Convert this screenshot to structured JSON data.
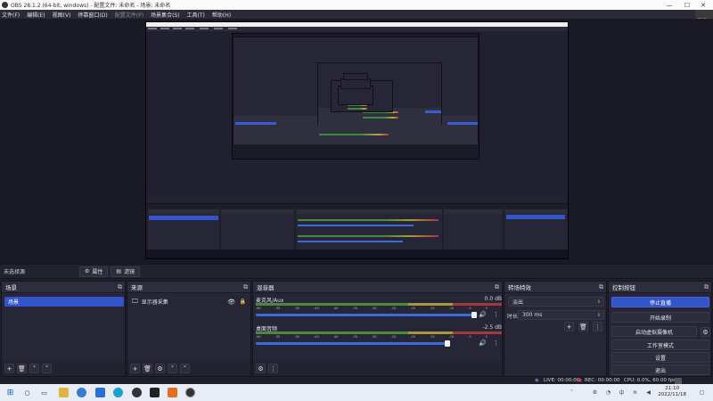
{
  "window": {
    "title": "OBS 28.1.2 (64-bit, windows) - 配置文件: 未命名 - 场景: 未命名",
    "minimize": "—",
    "maximize": "☐",
    "close": "✕",
    "badge": "翻譯中"
  },
  "menu": [
    "文件(F)",
    "编辑(E)",
    "视图(V)",
    "停靠窗口(D)",
    "配置文件(P)",
    "场景集合(S)",
    "工具(T)",
    "帮助(H)"
  ],
  "scenebar": {
    "label": "未选择源",
    "properties": "属性",
    "filters": "滤镜"
  },
  "scenes": {
    "title": "场景",
    "items": [
      "场景"
    ]
  },
  "sources": {
    "title": "来源",
    "items": [
      "显示器采集"
    ]
  },
  "mixer": {
    "title": "混音器",
    "tracks": [
      {
        "name": "麦克风/Aux",
        "db": "0.0 dB",
        "level": 0.63,
        "fader": 0.9
      },
      {
        "name": "桌面音频",
        "db": "-2.5 dB",
        "level": 0.63,
        "fader": 0.78
      }
    ],
    "ticks": [
      "-60",
      "-55",
      "-50",
      "-45",
      "-40",
      "-35",
      "-30",
      "-25",
      "-20",
      "-15",
      "-10",
      "-5",
      "0"
    ]
  },
  "transitions": {
    "title": "转场特效",
    "type": "淡出",
    "duration_label": "时长",
    "duration": "300 ms"
  },
  "controls": {
    "title": "控制按钮",
    "buttons": [
      "停止直播",
      "开始录制",
      "启动虚拟摄像机",
      "工作室模式",
      "设置",
      "退出"
    ]
  },
  "status": {
    "live": "LIVE: 00:00:00",
    "rec": "REC: 00:00:00",
    "cpu": "CPU: 0.0%, 60.00 fps"
  },
  "clock": {
    "time": "21:10",
    "date": "2022/11/18"
  },
  "colors": {
    "accent": "#3355cc",
    "dock_bg": "#262636",
    "meter_green": "#4a8a3d",
    "meter_yellow": "#a49a3a",
    "meter_red": "#a63a3a"
  }
}
